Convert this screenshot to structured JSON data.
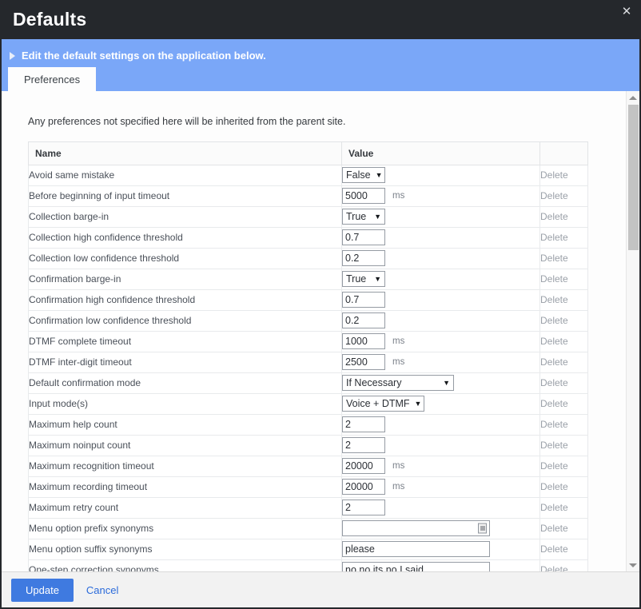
{
  "window": {
    "title": "Defaults",
    "close_icon": "close-icon"
  },
  "banner": {
    "caret_icon": "caret-right-icon",
    "text": "Edit the default settings on the application below."
  },
  "tabs": [
    {
      "label": "Preferences",
      "active": true
    }
  ],
  "main": {
    "intro": "Any preferences not specified here will be inherited from the parent site.",
    "columns": [
      "Name",
      "Value",
      ""
    ],
    "delete_label": "Delete",
    "rows": [
      {
        "name": "Avoid same mistake",
        "control": "select",
        "value": "False",
        "width": "w-bool",
        "unit": ""
      },
      {
        "name": "Before beginning of input timeout",
        "control": "text",
        "value": "5000",
        "width": "w-num",
        "unit": "ms"
      },
      {
        "name": "Collection barge-in",
        "control": "select",
        "value": "True",
        "width": "w-bool",
        "unit": ""
      },
      {
        "name": "Collection high confidence threshold",
        "control": "text",
        "value": "0.7",
        "width": "w-num",
        "unit": ""
      },
      {
        "name": "Collection low confidence threshold",
        "control": "text",
        "value": "0.2",
        "width": "w-num",
        "unit": ""
      },
      {
        "name": "Confirmation barge-in",
        "control": "select",
        "value": "True",
        "width": "w-bool",
        "unit": ""
      },
      {
        "name": "Confirmation high confidence threshold",
        "control": "text",
        "value": "0.7",
        "width": "w-num",
        "unit": ""
      },
      {
        "name": "Confirmation low confidence threshold",
        "control": "text",
        "value": "0.2",
        "width": "w-num",
        "unit": ""
      },
      {
        "name": "DTMF complete timeout",
        "control": "text",
        "value": "1000",
        "width": "w-num",
        "unit": "ms"
      },
      {
        "name": "DTMF inter-digit timeout",
        "control": "text",
        "value": "2500",
        "width": "w-num",
        "unit": "ms"
      },
      {
        "name": "Default confirmation mode",
        "control": "select",
        "value": "If Necessary",
        "width": "w-lg",
        "unit": ""
      },
      {
        "name": "Input mode(s)",
        "control": "select",
        "value": "Voice + DTMF",
        "width": "w-md",
        "unit": ""
      },
      {
        "name": "Maximum help count",
        "control": "text",
        "value": "2",
        "width": "w-num",
        "unit": ""
      },
      {
        "name": "Maximum noinput count",
        "control": "text",
        "value": "2",
        "width": "w-num",
        "unit": ""
      },
      {
        "name": "Maximum recognition timeout",
        "control": "text",
        "value": "20000",
        "width": "w-num",
        "unit": "ms"
      },
      {
        "name": "Maximum recording timeout",
        "control": "text",
        "value": "20000",
        "width": "w-num",
        "unit": "ms"
      },
      {
        "name": "Maximum retry count",
        "control": "text",
        "value": "2",
        "width": "w-num",
        "unit": ""
      },
      {
        "name": "Menu option prefix synonyms",
        "control": "autocomplete",
        "value": "",
        "width": "w-wide",
        "unit": ""
      },
      {
        "name": "Menu option suffix synonyms",
        "control": "text",
        "value": "please",
        "width": "w-wide",
        "unit": ""
      },
      {
        "name": "One-step correction synonyms",
        "control": "text",
        "value": "no,no its,no I said",
        "width": "w-wide",
        "unit": ""
      }
    ]
  },
  "scrollbar": {
    "up_icon": "scroll-up-arrow-icon",
    "down_icon": "scroll-down-arrow-icon"
  },
  "footer": {
    "update_label": "Update",
    "cancel_label": "Cancel"
  },
  "colors": {
    "titlebar": "#25282c",
    "banner": "#7aa7f8",
    "primary_button": "#3f7ae0",
    "link": "#2a6ada"
  }
}
